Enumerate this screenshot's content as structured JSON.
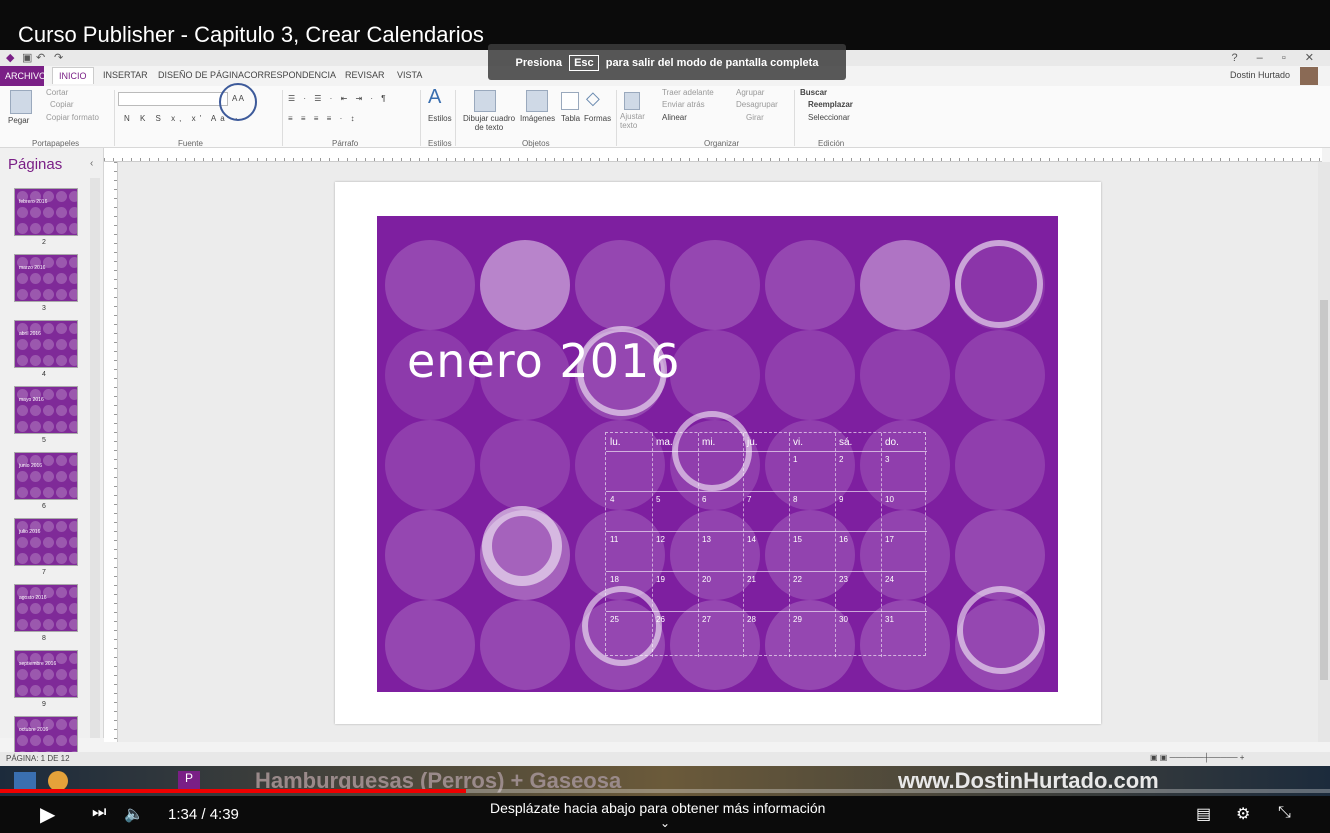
{
  "video": {
    "title": "Curso Publisher - Capitulo 3, Crear Calendarios",
    "time": "1:34 / 4:39",
    "hint": "Desplázate hacia abajo para obtener más información",
    "progress": 0.35
  },
  "banner": {
    "before": "Presiona",
    "key": "Esc",
    "after": "para salir del modo de pantalla completa"
  },
  "tabs": [
    "ARCHIVO",
    "INICIO",
    "INSERTAR",
    "DISEÑO DE PÁGINA",
    "CORRESPONDENCIA",
    "REVISAR",
    "VISTA"
  ],
  "user": "Dostin Hurtado",
  "ribbon": {
    "clipboard": {
      "paste": "Pegar",
      "cut": "Cortar",
      "copy": "Copiar",
      "format": "Copiar formato",
      "group": "Portapapeles"
    },
    "font": {
      "group": "Fuente"
    },
    "paragraph": {
      "group": "Párrafo"
    },
    "styles": {
      "label": "Estilos",
      "group": "Estilos"
    },
    "objects": {
      "textbox": "Dibujar cuadro de texto",
      "images": "Imágenes",
      "table": "Tabla",
      "shapes": "Formas",
      "group": "Objetos"
    },
    "arrange": {
      "wrap": "Ajustar texto",
      "front": "Traer adelante",
      "back": "Enviar atrás",
      "align": "Alinear",
      "group_btn": "Agrupar",
      "ungroup": "Desagrupar",
      "rotate": "Girar",
      "group": "Organizar"
    },
    "edit": {
      "find": "Buscar",
      "replace": "Reemplazar",
      "select": "Seleccionar",
      "group": "Edición"
    }
  },
  "pane": {
    "title": "Páginas",
    "pages": [
      {
        "num": "2",
        "label": "febrero 2016"
      },
      {
        "num": "3",
        "label": "marzo 2016"
      },
      {
        "num": "4",
        "label": "abril 2016"
      },
      {
        "num": "5",
        "label": "mayo 2016"
      },
      {
        "num": "6",
        "label": "junio 2016"
      },
      {
        "num": "7",
        "label": "julio 2016"
      },
      {
        "num": "8",
        "label": "agosto 2016"
      },
      {
        "num": "9",
        "label": "septiembre 2016"
      },
      {
        "num": "",
        "label": "octubre 2016"
      }
    ]
  },
  "calendar": {
    "title": "enero 2016",
    "days": [
      "lu.",
      "ma.",
      "mi.",
      "ju.",
      "vi.",
      "sá.",
      "do."
    ],
    "weeks": [
      [
        "",
        "",
        "",
        "",
        "1",
        "2",
        "3"
      ],
      [
        "4",
        "5",
        "6",
        "7",
        "8",
        "9",
        "10"
      ],
      [
        "11",
        "12",
        "13",
        "14",
        "15",
        "16",
        "17"
      ],
      [
        "18",
        "19",
        "20",
        "21",
        "22",
        "23",
        "24"
      ],
      [
        "25",
        "26",
        "27",
        "28",
        "29",
        "30",
        "31"
      ]
    ]
  },
  "status": {
    "page": "PÁGINA: 1 DE 12"
  },
  "taskbar": {
    "marquee": "Hamburguesas (Perros) + Gaseosa",
    "url": "www.DostinHurtado.com"
  },
  "colors": {
    "purple": "#7e1fa0",
    "accent": "#7a1f86"
  }
}
